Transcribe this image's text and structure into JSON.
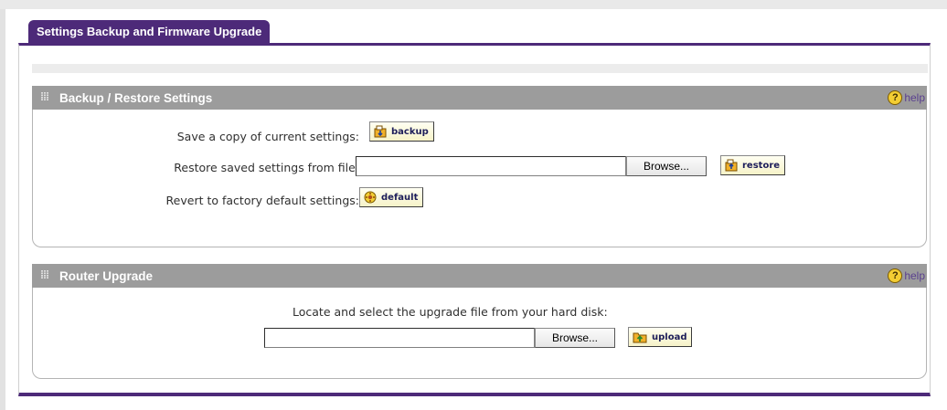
{
  "tab": {
    "title": "Settings Backup and Firmware Upgrade"
  },
  "backup_section": {
    "title": "Backup / Restore Settings",
    "help": "help",
    "save_label": "Save a copy of current settings:",
    "backup_button": "backup",
    "restore_label": "Restore saved settings from file:",
    "restore_file_value": "",
    "browse_label": "Browse...",
    "restore_button": "restore",
    "revert_label": "Revert to factory default settings:",
    "default_button": "default"
  },
  "upgrade_section": {
    "title": "Router Upgrade",
    "help": "help",
    "locate_label": "Locate and select the upgrade file from your hard disk:",
    "upgrade_file_value": "",
    "browse_label": "Browse...",
    "upload_button": "upload"
  },
  "colors": {
    "accent": "#4d2a79",
    "section_header": "#9c9c9c",
    "help_link": "#5a3f8f",
    "button_text": "#1d1d5a"
  },
  "icons": {
    "section_grip": "grip-icon",
    "help": "help-icon",
    "backup": "save-folder-icon",
    "restore": "restore-folder-icon",
    "default": "factory-default-icon",
    "upload": "upload-folder-icon"
  }
}
